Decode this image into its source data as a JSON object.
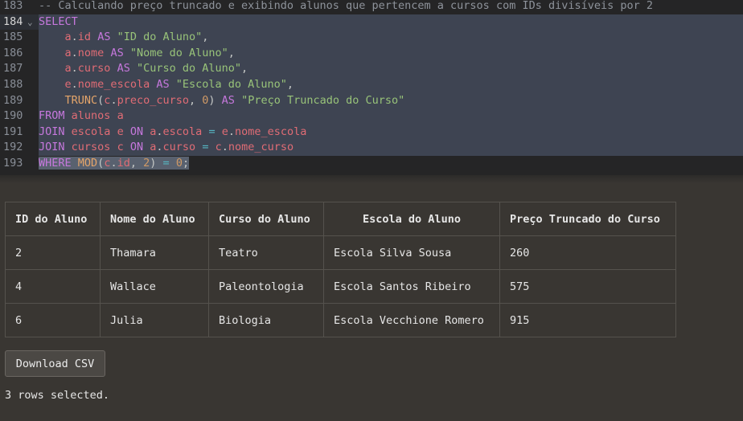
{
  "editor": {
    "lines": [
      {
        "num": "183",
        "active": false,
        "selected": false,
        "fold": false,
        "tokens": [
          {
            "t": "cm",
            "v": "-- Calculando preço truncado e exibindo alunos que pertencem a cursos com IDs divisíveis por 2"
          }
        ]
      },
      {
        "num": "184",
        "active": true,
        "selected": true,
        "fold": true,
        "tokens": [
          {
            "t": "kw",
            "v": "SELECT"
          }
        ]
      },
      {
        "num": "185",
        "active": false,
        "selected": true,
        "fold": false,
        "tokens": [
          {
            "t": "pl",
            "v": "    "
          },
          {
            "t": "var",
            "v": "a"
          },
          {
            "t": "pl",
            "v": "."
          },
          {
            "t": "var",
            "v": "id"
          },
          {
            "t": "pl",
            "v": " "
          },
          {
            "t": "kw",
            "v": "AS"
          },
          {
            "t": "pl",
            "v": " "
          },
          {
            "t": "str",
            "v": "\"ID do Aluno\""
          },
          {
            "t": "pl",
            "v": ","
          }
        ]
      },
      {
        "num": "186",
        "active": false,
        "selected": true,
        "fold": false,
        "tokens": [
          {
            "t": "pl",
            "v": "    "
          },
          {
            "t": "var",
            "v": "a"
          },
          {
            "t": "pl",
            "v": "."
          },
          {
            "t": "var",
            "v": "nome"
          },
          {
            "t": "pl",
            "v": " "
          },
          {
            "t": "kw",
            "v": "AS"
          },
          {
            "t": "pl",
            "v": " "
          },
          {
            "t": "str",
            "v": "\"Nome do Aluno\""
          },
          {
            "t": "pl",
            "v": ","
          }
        ]
      },
      {
        "num": "187",
        "active": false,
        "selected": true,
        "fold": false,
        "tokens": [
          {
            "t": "pl",
            "v": "    "
          },
          {
            "t": "var",
            "v": "a"
          },
          {
            "t": "pl",
            "v": "."
          },
          {
            "t": "var",
            "v": "curso"
          },
          {
            "t": "pl",
            "v": " "
          },
          {
            "t": "kw",
            "v": "AS"
          },
          {
            "t": "pl",
            "v": " "
          },
          {
            "t": "str",
            "v": "\"Curso do Aluno\""
          },
          {
            "t": "pl",
            "v": ","
          }
        ]
      },
      {
        "num": "188",
        "active": false,
        "selected": true,
        "fold": false,
        "tokens": [
          {
            "t": "pl",
            "v": "    "
          },
          {
            "t": "var",
            "v": "e"
          },
          {
            "t": "pl",
            "v": "."
          },
          {
            "t": "var",
            "v": "nome_escola"
          },
          {
            "t": "pl",
            "v": " "
          },
          {
            "t": "kw",
            "v": "AS"
          },
          {
            "t": "pl",
            "v": " "
          },
          {
            "t": "str",
            "v": "\"Escola do Aluno\""
          },
          {
            "t": "pl",
            "v": ","
          }
        ]
      },
      {
        "num": "189",
        "active": false,
        "selected": true,
        "fold": false,
        "tokens": [
          {
            "t": "pl",
            "v": "    "
          },
          {
            "t": "fn",
            "v": "TRUNC"
          },
          {
            "t": "pl",
            "v": "("
          },
          {
            "t": "var",
            "v": "c"
          },
          {
            "t": "pl",
            "v": "."
          },
          {
            "t": "var",
            "v": "preco_curso"
          },
          {
            "t": "pl",
            "v": ", "
          },
          {
            "t": "num",
            "v": "0"
          },
          {
            "t": "pl",
            "v": ") "
          },
          {
            "t": "kw",
            "v": "AS"
          },
          {
            "t": "pl",
            "v": " "
          },
          {
            "t": "str",
            "v": "\"Preço Truncado do Curso\""
          }
        ]
      },
      {
        "num": "190",
        "active": false,
        "selected": true,
        "fold": false,
        "tokens": [
          {
            "t": "kw",
            "v": "FROM"
          },
          {
            "t": "pl",
            "v": " "
          },
          {
            "t": "var",
            "v": "alunos"
          },
          {
            "t": "pl",
            "v": " "
          },
          {
            "t": "var",
            "v": "a"
          }
        ]
      },
      {
        "num": "191",
        "active": false,
        "selected": true,
        "fold": false,
        "tokens": [
          {
            "t": "kw",
            "v": "JOIN"
          },
          {
            "t": "pl",
            "v": " "
          },
          {
            "t": "var",
            "v": "escola"
          },
          {
            "t": "pl",
            "v": " "
          },
          {
            "t": "var",
            "v": "e"
          },
          {
            "t": "pl",
            "v": " "
          },
          {
            "t": "kw",
            "v": "ON"
          },
          {
            "t": "pl",
            "v": " "
          },
          {
            "t": "var",
            "v": "a"
          },
          {
            "t": "pl",
            "v": "."
          },
          {
            "t": "var",
            "v": "escola"
          },
          {
            "t": "pl",
            "v": " "
          },
          {
            "t": "op",
            "v": "="
          },
          {
            "t": "pl",
            "v": " "
          },
          {
            "t": "var",
            "v": "e"
          },
          {
            "t": "pl",
            "v": "."
          },
          {
            "t": "var",
            "v": "nome_escola"
          }
        ]
      },
      {
        "num": "192",
        "active": false,
        "selected": true,
        "fold": false,
        "tokens": [
          {
            "t": "kw",
            "v": "JOIN"
          },
          {
            "t": "pl",
            "v": " "
          },
          {
            "t": "var",
            "v": "cursos"
          },
          {
            "t": "pl",
            "v": " "
          },
          {
            "t": "var",
            "v": "c"
          },
          {
            "t": "pl",
            "v": " "
          },
          {
            "t": "kw",
            "v": "ON"
          },
          {
            "t": "pl",
            "v": " "
          },
          {
            "t": "var",
            "v": "a"
          },
          {
            "t": "pl",
            "v": "."
          },
          {
            "t": "var",
            "v": "curso"
          },
          {
            "t": "pl",
            "v": " "
          },
          {
            "t": "op",
            "v": "="
          },
          {
            "t": "pl",
            "v": " "
          },
          {
            "t": "var",
            "v": "c"
          },
          {
            "t": "pl",
            "v": "."
          },
          {
            "t": "var",
            "v": "nome_curso"
          }
        ]
      },
      {
        "num": "193",
        "active": false,
        "selected": false,
        "fold": false,
        "tokens": [
          {
            "t": "kw",
            "v": "WHERE",
            "hl": true
          },
          {
            "t": "pl",
            "v": " ",
            "hl": true
          },
          {
            "t": "fn",
            "v": "MOD",
            "hl": true
          },
          {
            "t": "pl",
            "v": "(",
            "hl": true
          },
          {
            "t": "var",
            "v": "c",
            "hl": true
          },
          {
            "t": "pl",
            "v": ".",
            "hl": true
          },
          {
            "t": "var",
            "v": "id",
            "hl": true
          },
          {
            "t": "pl",
            "v": ", ",
            "hl": true
          },
          {
            "t": "num",
            "v": "2",
            "hl": true
          },
          {
            "t": "pl",
            "v": ") ",
            "hl": true
          },
          {
            "t": "op",
            "v": "=",
            "hl": true
          },
          {
            "t": "pl",
            "v": " ",
            "hl": true
          },
          {
            "t": "num",
            "v": "0",
            "hl": true
          },
          {
            "t": "pl",
            "v": ";",
            "hl": true
          }
        ]
      }
    ]
  },
  "results": {
    "columns": [
      "ID do Aluno",
      "Nome do Aluno",
      "Curso do Aluno",
      "Escola do Aluno",
      "Preço Truncado do Curso"
    ],
    "rows": [
      [
        "2",
        "Thamara",
        "Teatro",
        "Escola Silva Sousa",
        "260"
      ],
      [
        "4",
        "Wallace",
        "Paleontologia",
        "Escola Santos Ribeiro",
        "575"
      ],
      [
        "6",
        "Julia",
        "Biologia",
        "Escola Vecchione Romero",
        "915"
      ]
    ]
  },
  "download_label": "Download CSV",
  "status_text": "3 rows selected.",
  "fold_icon": "chevron-down-icon"
}
